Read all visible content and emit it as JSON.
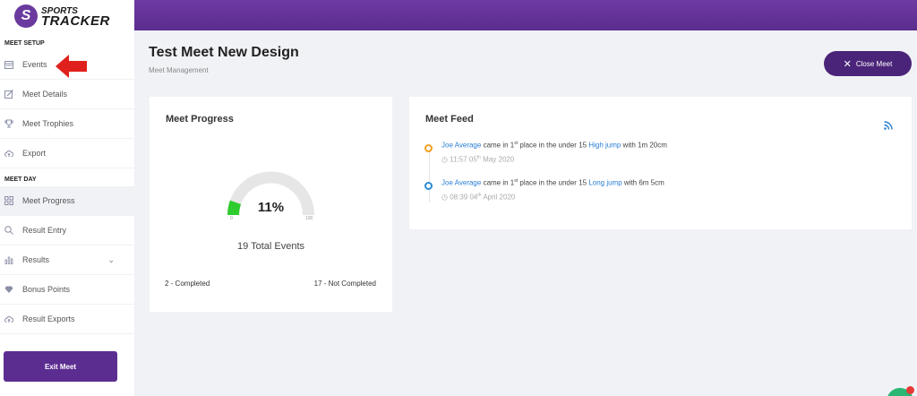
{
  "app": {
    "logo_badge": "S",
    "logo_line1": "SPORTS",
    "logo_line2": "TRACKER",
    "accent_color": "#5c2d91"
  },
  "sidebar": {
    "meet_setup_label": "MEET SETUP",
    "meet_setup_items": [
      {
        "label": "Events",
        "icon": "calendar-icon"
      },
      {
        "label": "Meet Details",
        "icon": "edit-icon"
      },
      {
        "label": "Meet Trophies",
        "icon": "trophy-icon"
      },
      {
        "label": "Export",
        "icon": "cloud-upload-icon"
      }
    ],
    "meet_day_label": "MEET DAY",
    "meet_day_items": [
      {
        "label": "Meet Progress",
        "icon": "grid-icon",
        "active": true
      },
      {
        "label": "Result Entry",
        "icon": "search-icon"
      },
      {
        "label": "Results",
        "icon": "bar-chart-icon",
        "expandable": true
      },
      {
        "label": "Bonus Points",
        "icon": "diamond-icon"
      },
      {
        "label": "Result Exports",
        "icon": "cloud-upload-icon"
      }
    ],
    "exit_label": "Exit Meet"
  },
  "header": {
    "title": "Test Meet New Design",
    "breadcrumb": "Meet Management",
    "close_label": "Close Meet"
  },
  "progress": {
    "title": "Meet Progress",
    "percent": 11,
    "percent_label": "11%",
    "min_label": "0",
    "max_label": "100",
    "total_label": "19 Total Events",
    "completed_label": "2 - Completed",
    "not_completed_label": "17 - Not Completed",
    "fill_color": "#2ecc2e",
    "track_color": "#e6e6e6"
  },
  "feed": {
    "title": "Meet Feed",
    "items": [
      {
        "athlete": "Joe Average",
        "text1": " came in 1",
        "ordinal": "st",
        "text2": " place in the under 15 ",
        "event": "High jump",
        "text3": " with 1m 20cm",
        "time": "11:57 05",
        "time_ordinal": "th",
        "time_rest": " May 2020",
        "dot_color": "orange"
      },
      {
        "athlete": "Joe Average",
        "text1": " came in 1",
        "ordinal": "st",
        "text2": " place in the under 15 ",
        "event": "Long jump",
        "text3": " with 6m 5cm",
        "time": "08:39 04",
        "time_ordinal": "th",
        "time_rest": " April 2020",
        "dot_color": "blue"
      }
    ]
  }
}
